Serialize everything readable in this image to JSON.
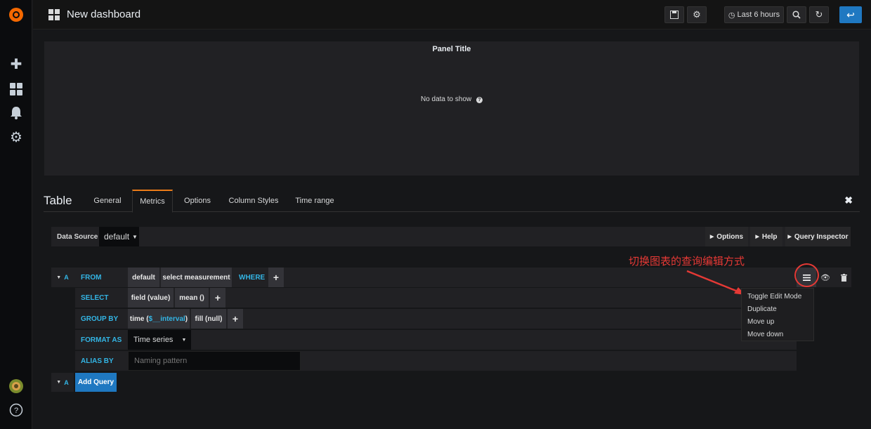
{
  "topbar": {
    "title": "New dashboard",
    "time_range": "Last 6 hours"
  },
  "panel": {
    "title": "Panel Title",
    "empty_text": "No data to show"
  },
  "editor": {
    "title": "Table",
    "tabs": [
      "General",
      "Metrics",
      "Options",
      "Column Styles",
      "Time range"
    ],
    "active_tab": "Metrics"
  },
  "datasource": {
    "label": "Data Source",
    "value": "default",
    "options_btn": "Options",
    "help_btn": "Help",
    "inspector_btn": "Query Inspector"
  },
  "query": {
    "letter": "A",
    "from_kw": "FROM",
    "from_db": "default",
    "from_measure": "select measurement",
    "where_kw": "WHERE",
    "select_kw": "SELECT",
    "select_field": "field (value)",
    "select_fn": "mean ()",
    "groupby_kw": "GROUP BY",
    "groupby_time": "time ($__interval)",
    "groupby_fill": "fill (null)",
    "format_kw": "FORMAT AS",
    "format_val": "Time series",
    "alias_kw": "ALIAS BY",
    "alias_ph": "Naming pattern"
  },
  "add_query": {
    "letter": "A",
    "label": "Add Query"
  },
  "annotation": {
    "text": "切换图表的查询编辑方式"
  },
  "menu": {
    "items": [
      "Toggle Edit Mode",
      "Duplicate",
      "Move up",
      "Move down"
    ]
  }
}
